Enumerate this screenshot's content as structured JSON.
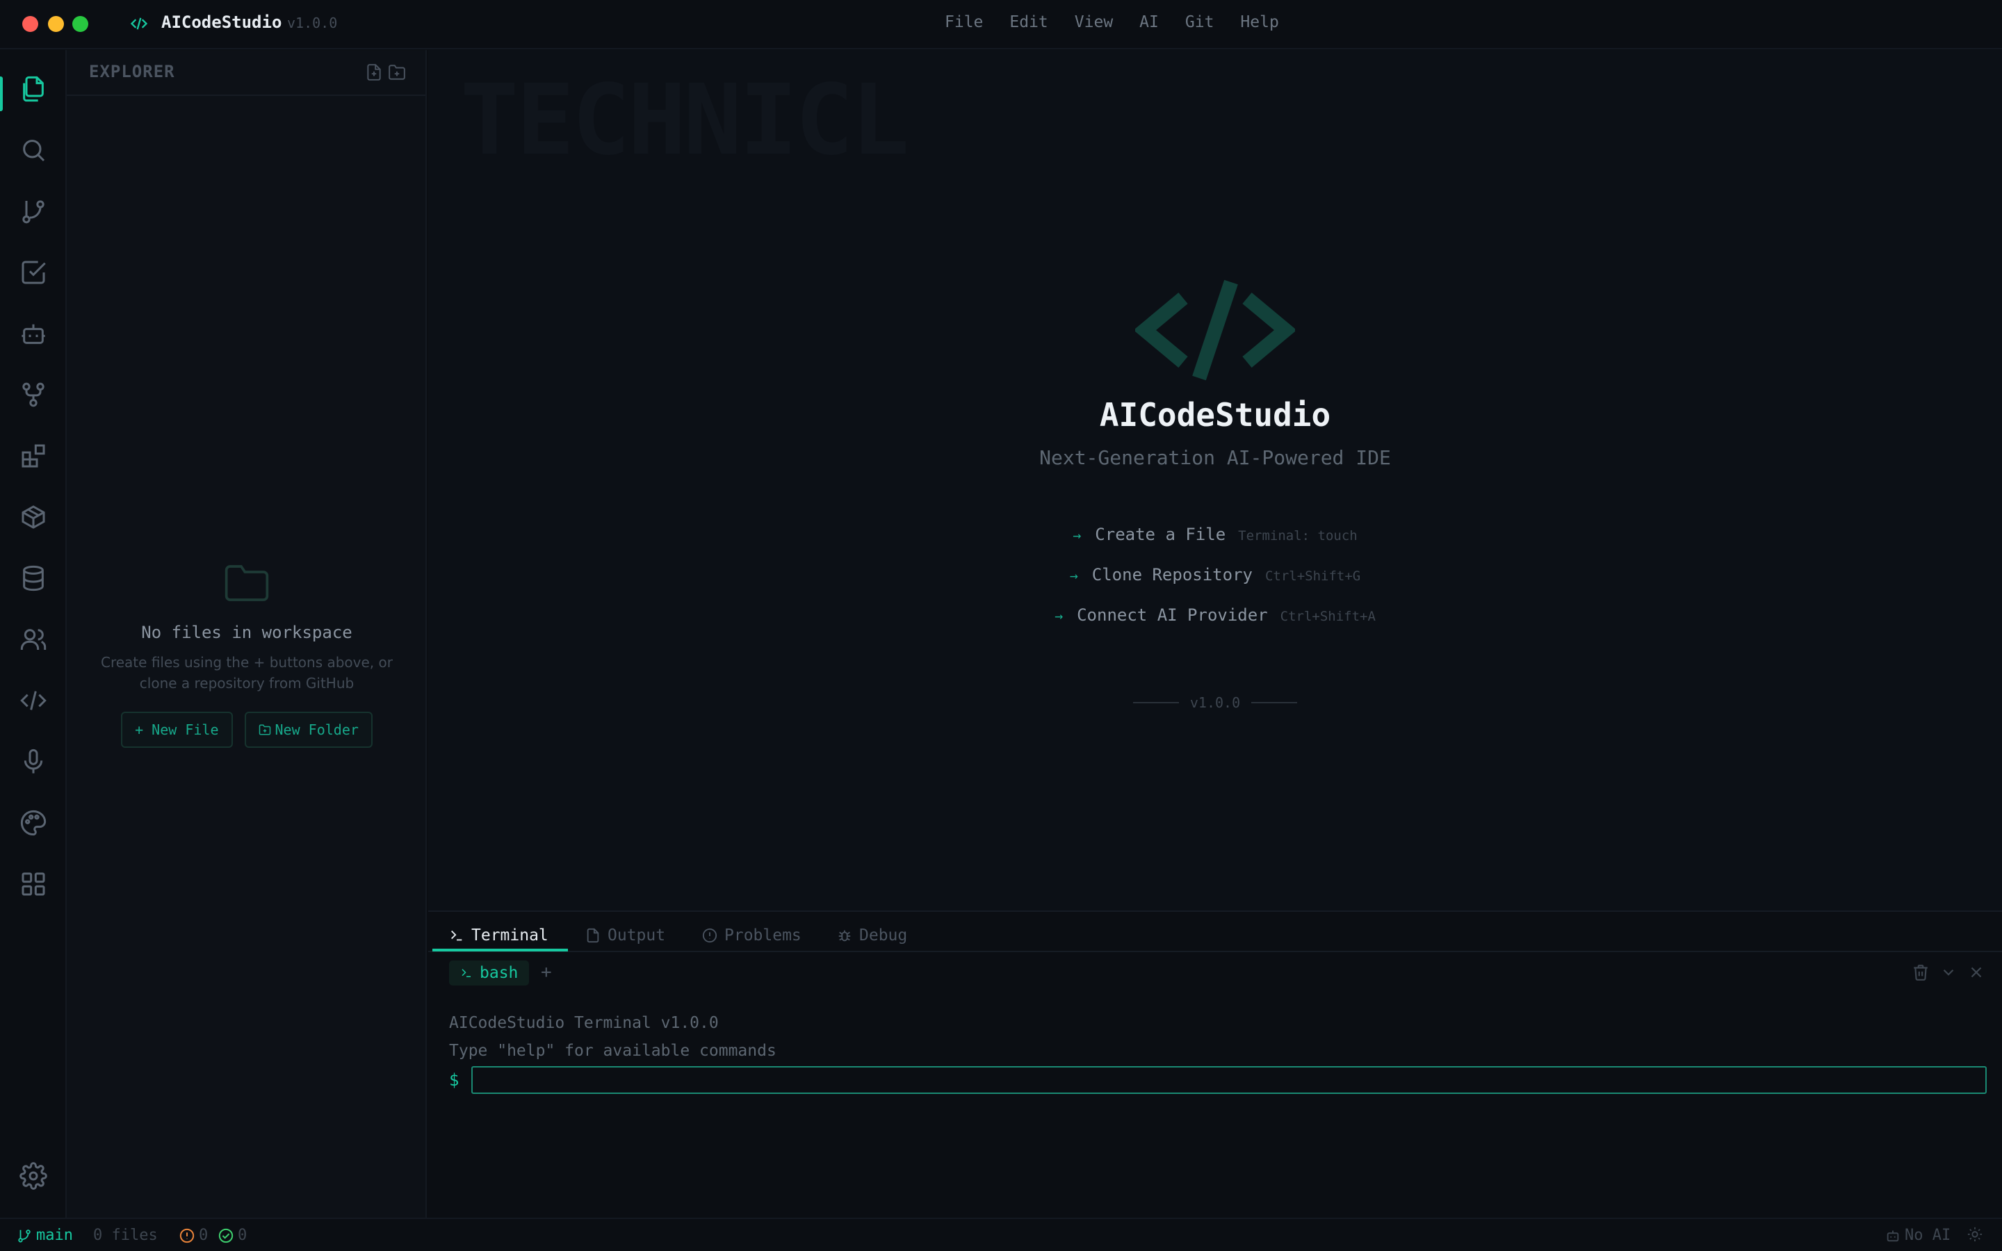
{
  "titlebar": {
    "app_name": "AICodeStudio",
    "version": "v1.0.0",
    "menu": [
      "File",
      "Edit",
      "View",
      "AI",
      "Git",
      "Help"
    ]
  },
  "activity_bar": {
    "items": [
      "files-icon",
      "search-icon",
      "source-control-icon",
      "tasks-icon",
      "ai-bot-icon",
      "git-graph-icon",
      "extensions-icon",
      "packages-icon",
      "database-icon",
      "users-icon",
      "code-icon",
      "microphone-icon",
      "palette-icon",
      "apps-grid-icon"
    ],
    "active": "files-icon",
    "bottom": "gear-icon"
  },
  "explorer": {
    "title": "EXPLORER",
    "empty_title": "No files in workspace",
    "empty_desc_line1": "Create files using the + buttons above, or",
    "empty_desc_line2": "clone a repository from GitHub",
    "new_file_label": "+ New File",
    "new_folder_label": "New Folder"
  },
  "editor": {
    "ghost_text": "TECHNICL",
    "welcome_title": "AICodeStudio",
    "welcome_subtitle": "Next-Generation AI-Powered IDE",
    "actions": [
      {
        "arrow": "→",
        "label": "Create a File",
        "shortcut": "Terminal: touch"
      },
      {
        "arrow": "→",
        "label": "Clone Repository",
        "shortcut": "Ctrl+Shift+G"
      },
      {
        "arrow": "→",
        "label": "Connect AI Provider",
        "shortcut": "Ctrl+Shift+A"
      }
    ],
    "version_footer": "v1.0.0"
  },
  "panel": {
    "tabs": [
      "Terminal",
      "Output",
      "Problems",
      "Debug"
    ],
    "active_tab": "Terminal",
    "terminal_tab": "bash",
    "add_label": "+",
    "lines": [
      "AICodeStudio Terminal v1.0.0",
      "Type \"help\" for available commands"
    ],
    "prompt": "$",
    "input_value": ""
  },
  "statusbar": {
    "branch": "main",
    "files": "0 files",
    "warnings": "0",
    "checks": "0",
    "ai_status": "No AI"
  },
  "colors": {
    "accent": "#17c9a0",
    "background": "#0b0e13",
    "editor_bg": "#0c1016",
    "warning": "#e8833a",
    "ok": "#3ecf6e"
  }
}
